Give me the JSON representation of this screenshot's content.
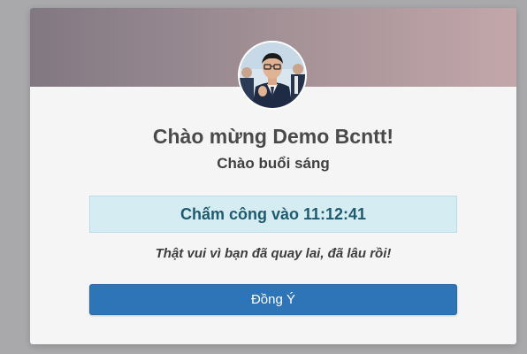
{
  "modal": {
    "greeting": "Chào mừng Demo Bcntt!",
    "subgreeting": "Chào buổi sáng",
    "checkin": "Chấm công vào 11:12:41",
    "message": "Thật vui vì bạn đã quay lai, đã lâu rồi!",
    "confirm_label": "Đồng Ý",
    "avatar_icon": "user-avatar-photo"
  },
  "colors": {
    "header_gradient_start": "#827882",
    "header_gradient_end": "#c3a6aa",
    "checkin_bg": "#d5ecf2",
    "checkin_text": "#1f5b6e",
    "button_bg": "#2e75b8"
  }
}
